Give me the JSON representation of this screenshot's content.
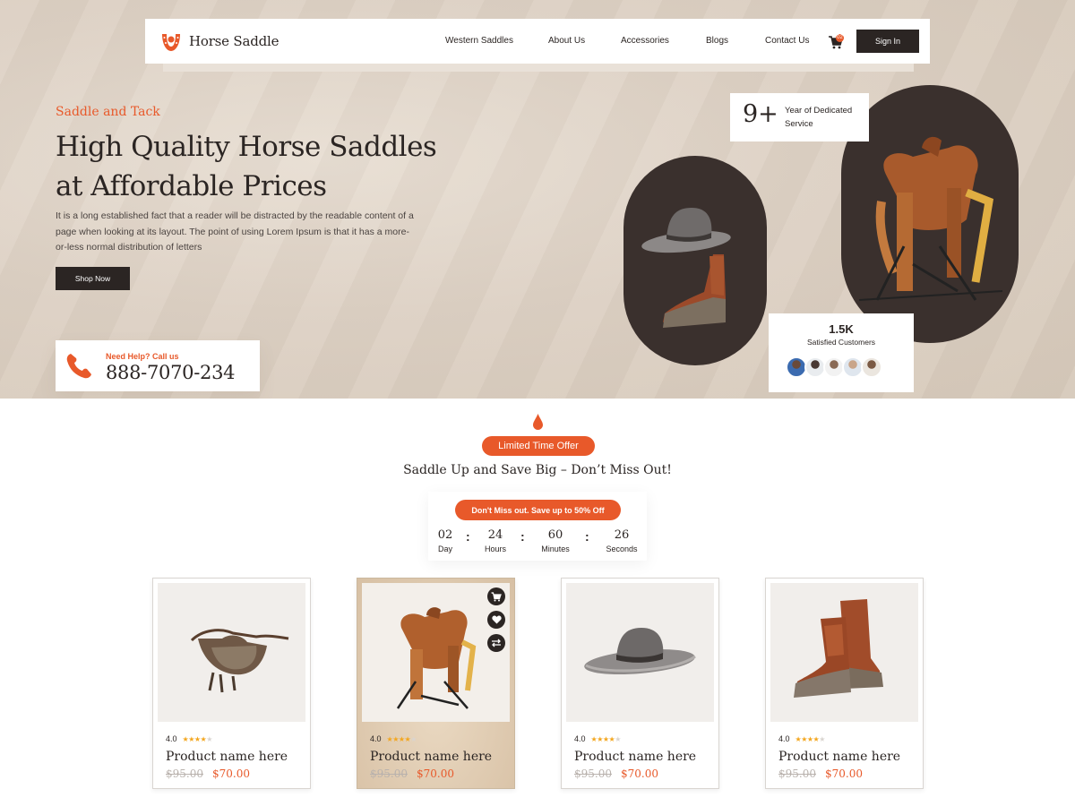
{
  "brand": {
    "name": "Horse Saddle",
    "accent": "#e8592a",
    "dark": "#2b2523"
  },
  "nav": {
    "links": [
      "Western Saddles",
      "About Us",
      "Accessories",
      "Blogs",
      "Contact Us"
    ],
    "cart_count": "02",
    "signin_label": "Sign In"
  },
  "hero": {
    "eyebrow": "Saddle and Tack",
    "headline_line1": "High Quality Horse Saddles",
    "headline_line2": "at Affordable Prices",
    "description": "It is a long established fact that a reader will be distracted by the readable content of a page when looking at its layout. The point of using Lorem Ipsum is that it has a more-or-less normal distribution of letters",
    "cta_label": "Shop Now",
    "help_label": "Need Help? Call us",
    "phone": "888-7070-234",
    "experience_number": "9+",
    "experience_text": "Year of Dedicated Service",
    "customers_number": "1.5K",
    "customers_label": "Satisfied Customers"
  },
  "offer": {
    "tag": "Limited Time Offer",
    "title": "Saddle Up and Save Big – Don’t Miss Out!",
    "banner": "Don't Miss out. Save up to 50% Off",
    "countdown": [
      {
        "value": "02",
        "label": "Day"
      },
      {
        "value": "24",
        "label": "Hours"
      },
      {
        "value": "60",
        "label": "Minutes"
      },
      {
        "value": "26",
        "label": "Seconds"
      }
    ]
  },
  "products": [
    {
      "rating": "4.0",
      "stars": 4,
      "name": "Product name here",
      "old_price": "$95.00",
      "price": "$70.00",
      "image": "english-saddle"
    },
    {
      "rating": "4.0",
      "stars": 4,
      "name": "Product name here",
      "old_price": "$95.00",
      "price": "$70.00",
      "image": "western-saddle"
    },
    {
      "rating": "4.0",
      "stars": 4,
      "name": "Product name here",
      "old_price": "$95.00",
      "price": "$70.00",
      "image": "cowboy-hat"
    },
    {
      "rating": "4.0",
      "stars": 4,
      "name": "Product name here",
      "old_price": "$95.00",
      "price": "$70.00",
      "image": "cowboy-boots"
    }
  ],
  "product_actions": [
    "cart-icon",
    "heart-icon",
    "compare-icon"
  ]
}
